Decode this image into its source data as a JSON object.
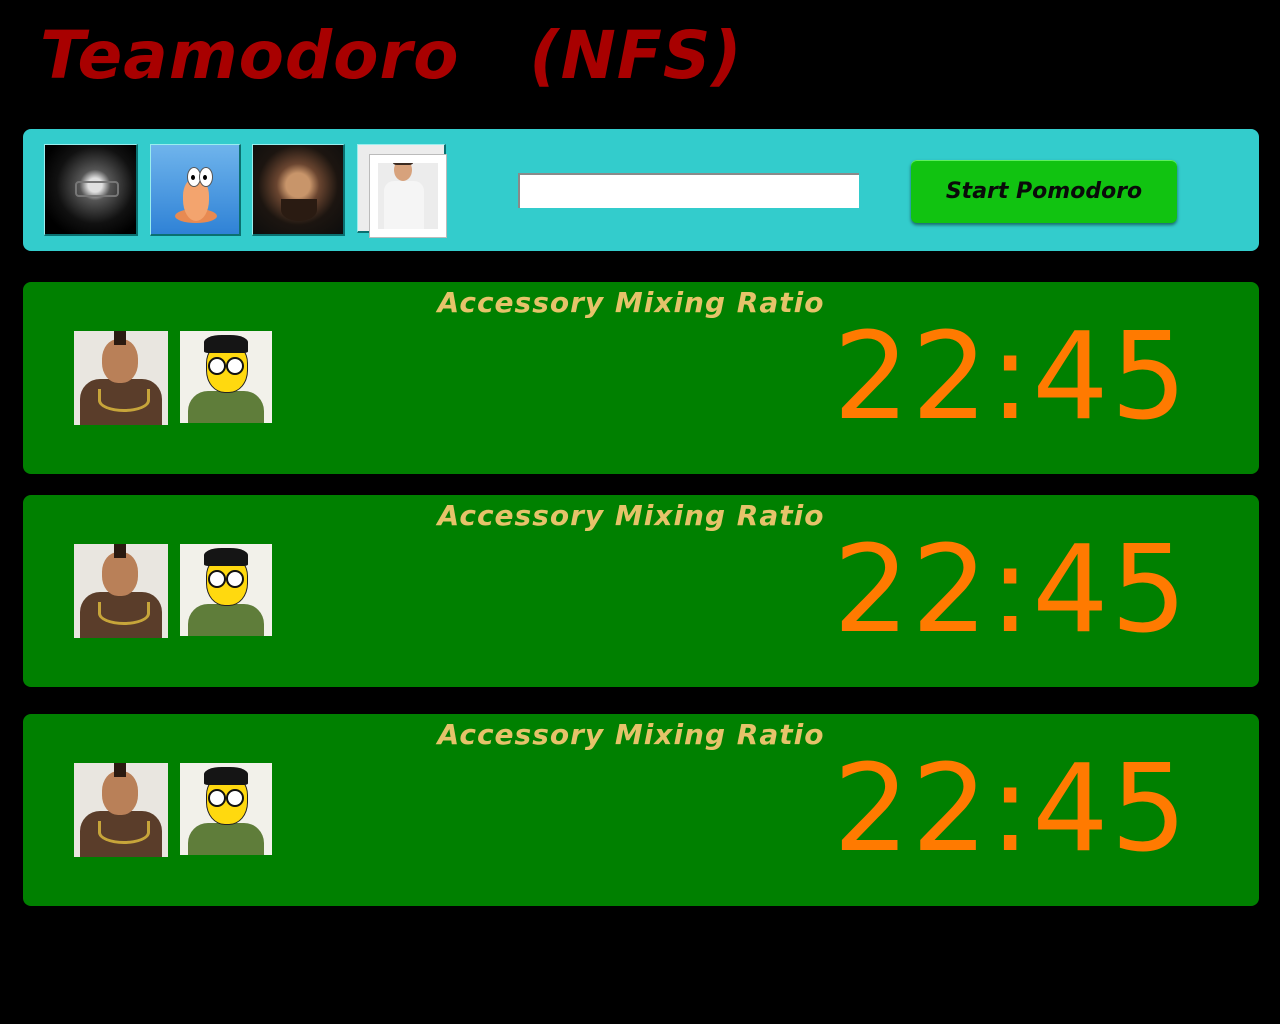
{
  "app": {
    "title_main": "Teamodoro",
    "title_team": "(NFS)"
  },
  "toolbar": {
    "team_avatars": [
      {
        "name": "avatar-glasses-man"
      },
      {
        "name": "avatar-worm-cartoon"
      },
      {
        "name": "avatar-bearded-man"
      },
      {
        "name": "avatar-man-with-frame"
      }
    ],
    "task_input": {
      "value": "",
      "placeholder": ""
    },
    "start_button_label": "Start Pomodoro"
  },
  "pomodoros": [
    {
      "task": "Accessory Mixing Ratio",
      "time": "22:45",
      "members": [
        "member-mohawk-man",
        "member-cartoon-character"
      ]
    },
    {
      "task": "Accessory Mixing Ratio",
      "time": "22:45",
      "members": [
        "member-mohawk-man",
        "member-cartoon-character"
      ]
    },
    {
      "task": "Accessory Mixing Ratio",
      "time": "22:45",
      "members": [
        "member-mohawk-man",
        "member-cartoon-character"
      ]
    }
  ],
  "colors": {
    "background": "#000000",
    "title": "#a80000",
    "toolbar": "#33cccc",
    "start_button": "#11c311",
    "card": "#008000",
    "task_title": "#e5c36a",
    "timer": "#ff7a00"
  }
}
